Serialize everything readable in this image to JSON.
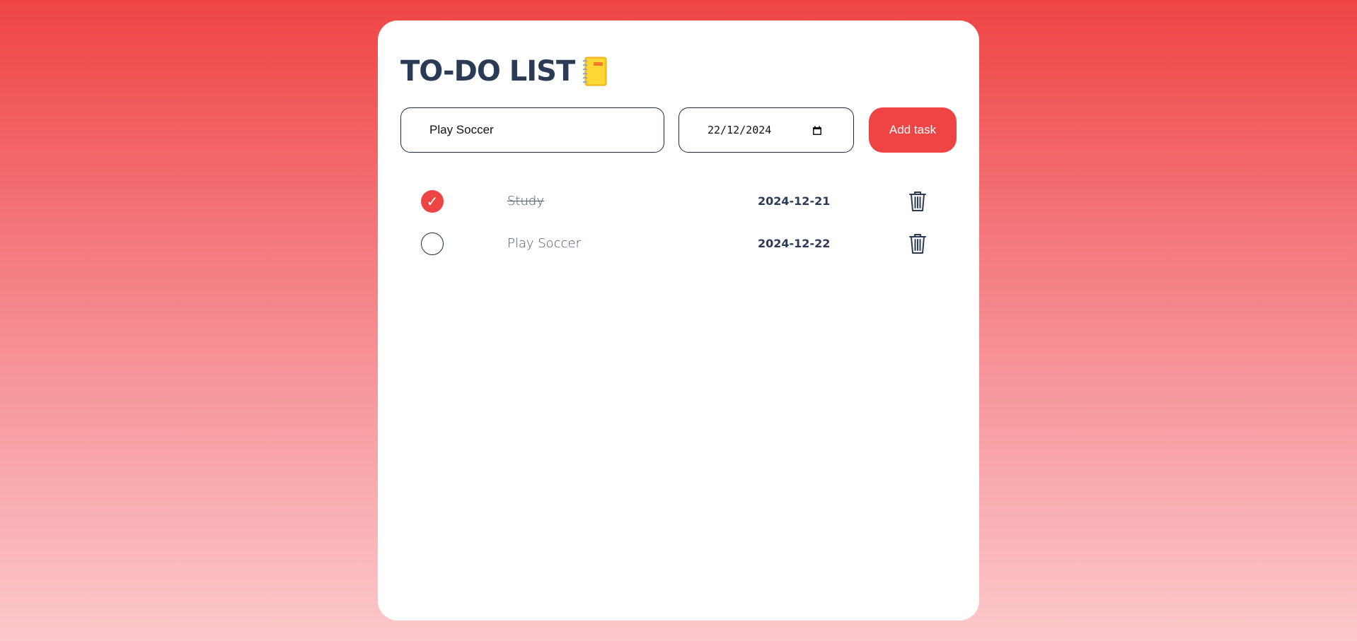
{
  "app": {
    "title": "TO-DO LIST",
    "title_icon": "notebook-icon"
  },
  "form": {
    "task_value": "Play Soccer",
    "date_value": "22/12/2024",
    "date_icon": "calendar-icon",
    "add_label": "Add task"
  },
  "tasks": [
    {
      "name": "Study",
      "date": "2024-12-21",
      "completed": true,
      "icon": "trash-icon"
    },
    {
      "name": "Play Soccer",
      "date": "2024-12-22",
      "completed": false,
      "icon": "trash-icon"
    }
  ],
  "colors": {
    "accent": "#ef4444",
    "text_dark": "#2b3a55"
  }
}
